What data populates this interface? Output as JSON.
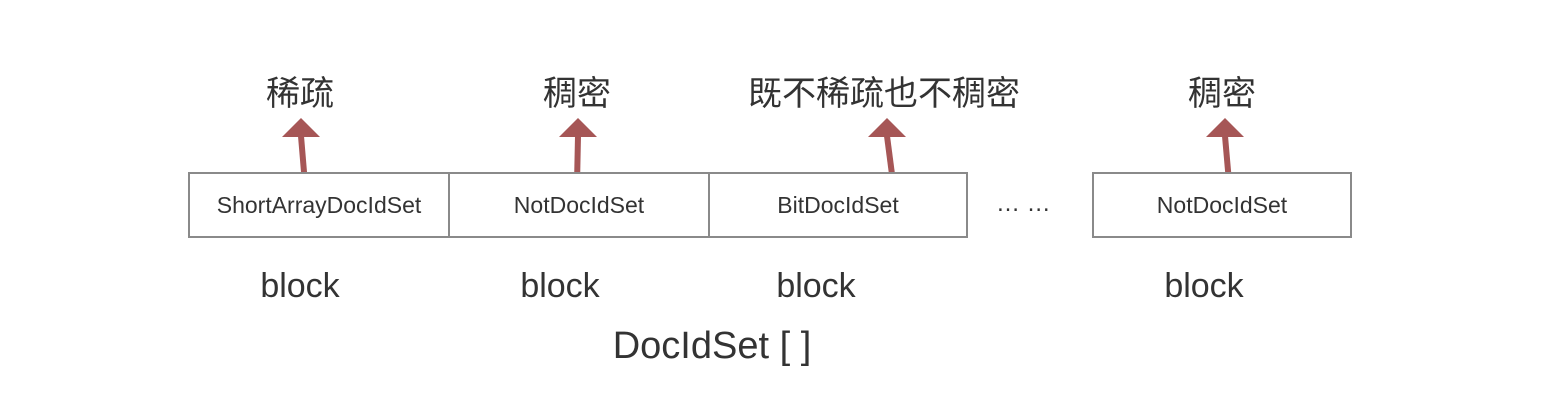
{
  "labels_top": [
    "稀疏",
    "稠密",
    "既不稀疏也不稠密",
    "稠密"
  ],
  "boxes": [
    "ShortArrayDocIdSet",
    "NotDocIdSet",
    "BitDocIdSet",
    "NotDocIdSet"
  ],
  "ellipsis": "… …",
  "block_labels": [
    "block",
    "block",
    "block",
    "block"
  ],
  "array_label": "DocIdSet [ ]",
  "colors": {
    "arrow": "#a65656",
    "box_border": "#8a8a8a",
    "text": "#333333"
  }
}
